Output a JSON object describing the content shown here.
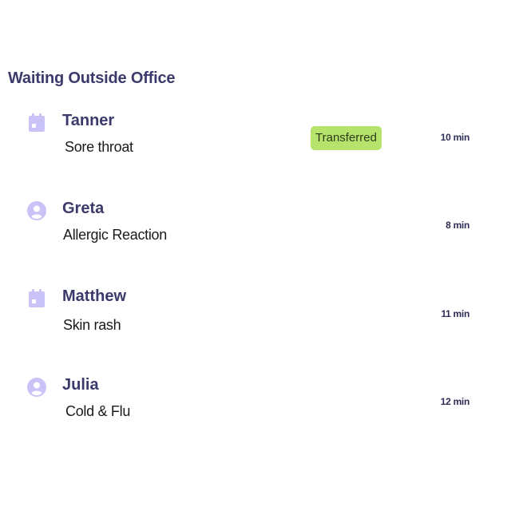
{
  "section": {
    "title": "Waiting Outside Office"
  },
  "patients": [
    {
      "name": "Tanner",
      "reason": "Sore throat",
      "icon": "calendar-icon",
      "badge": "Transferred",
      "wait": "10 min"
    },
    {
      "name": "Greta",
      "reason": "Allergic Reaction",
      "icon": "person-icon",
      "wait": "8 min"
    },
    {
      "name": "Matthew",
      "reason": "Skin rash",
      "icon": "calendar-icon",
      "wait": "11 min"
    },
    {
      "name": "Julia",
      "reason": "Cold & Flu",
      "icon": "person-icon",
      "wait": "12 min"
    }
  ],
  "colors": {
    "heading": "#3b3a6b",
    "icon": "#c9c3f7",
    "badge_bg": "#b6e36c"
  }
}
